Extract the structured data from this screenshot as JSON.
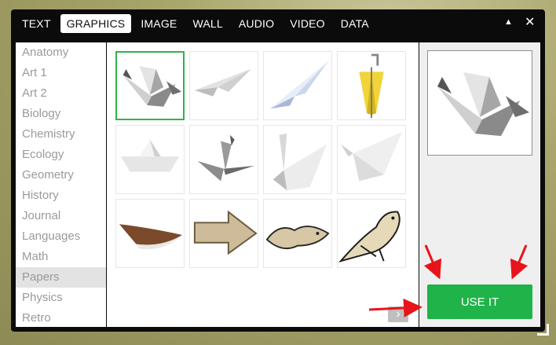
{
  "tabs": [
    {
      "label": "TEXT",
      "active": false
    },
    {
      "label": "GRAPHICS",
      "active": true
    },
    {
      "label": "IMAGE",
      "active": false
    },
    {
      "label": "WALL",
      "active": false
    },
    {
      "label": "AUDIO",
      "active": false
    },
    {
      "label": "VIDEO",
      "active": false
    },
    {
      "label": "DATA",
      "active": false
    }
  ],
  "window_controls": {
    "collapse_icon": "▲",
    "close_icon": "✕"
  },
  "categories": [
    "Anatomy",
    "Art 1",
    "Art 2",
    "Biology",
    "Chemistry",
    "Ecology",
    "Geometry",
    "History",
    "Journal",
    "Languages",
    "Math",
    "Papers",
    "Physics",
    "Retro"
  ],
  "active_category": "Papers",
  "thumbnails": [
    {
      "icon": "paper-crane-icon",
      "selected": true
    },
    {
      "icon": "paper-airplane-flat-icon",
      "selected": false
    },
    {
      "icon": "paper-airplane-blue-icon",
      "selected": false
    },
    {
      "icon": "paper-umbrella-yellow-icon",
      "selected": false
    },
    {
      "icon": "paper-boat-icon",
      "selected": false
    },
    {
      "icon": "paper-crane-gray-icon",
      "selected": false
    },
    {
      "icon": "paper-swan-icon",
      "selected": false
    },
    {
      "icon": "paper-bird-icon",
      "selected": false
    },
    {
      "icon": "paper-boat-brown-icon",
      "selected": false
    },
    {
      "icon": "paper-arrow-icon",
      "selected": false
    },
    {
      "icon": "paper-hand-bird-icon",
      "selected": false
    },
    {
      "icon": "paper-sparrow-icon",
      "selected": false
    }
  ],
  "next_icon": "›",
  "preview": {
    "icon": "paper-crane-icon"
  },
  "use_button_label": "USE IT",
  "colors": {
    "accent_green": "#1fb34a",
    "annotation_red": "#e8141b"
  }
}
